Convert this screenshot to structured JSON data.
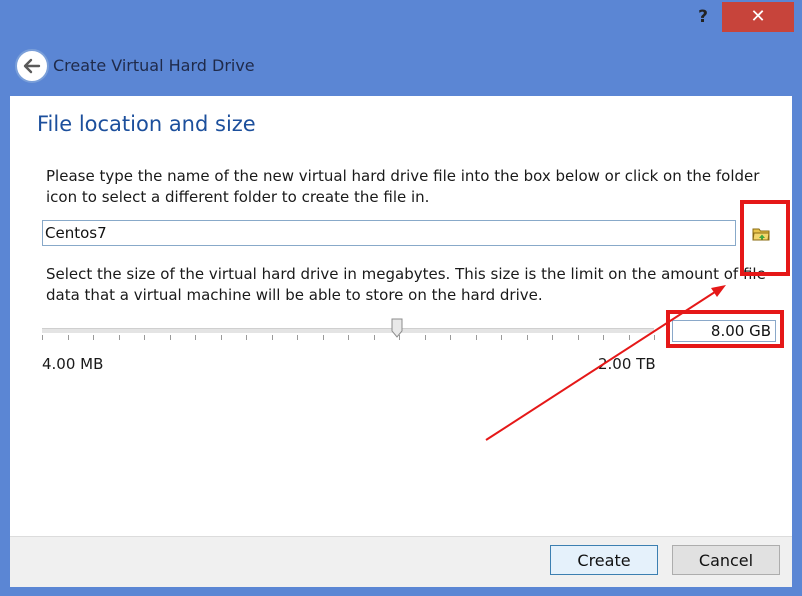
{
  "titlebar": {
    "help_label": "?",
    "close_label": "✕"
  },
  "header": {
    "title": "Create Virtual Hard Drive",
    "back_icon": "back-arrow-icon"
  },
  "section": {
    "title": "File location and size"
  },
  "file": {
    "description": "Please type the name of the new virtual hard drive file into the box below or click on the folder icon to select a different folder to create the file in.",
    "value": "Centos7",
    "folder_icon": "folder-icon"
  },
  "size": {
    "description": "Select the size of the virtual hard drive in megabytes. This size is the limit on the amount of file data that a virtual machine will be able to store on the hard drive.",
    "value": "8.00 GB",
    "slider_fraction": 0.58,
    "min_label": "4.00 MB",
    "max_label": "2.00 TB"
  },
  "buttons": {
    "create_label": "Create",
    "cancel_label": "Cancel"
  },
  "colors": {
    "frame": "#5b86d4",
    "title_accent": "#1c4f9c",
    "annotation": "#e51818",
    "close": "#c7443b"
  }
}
